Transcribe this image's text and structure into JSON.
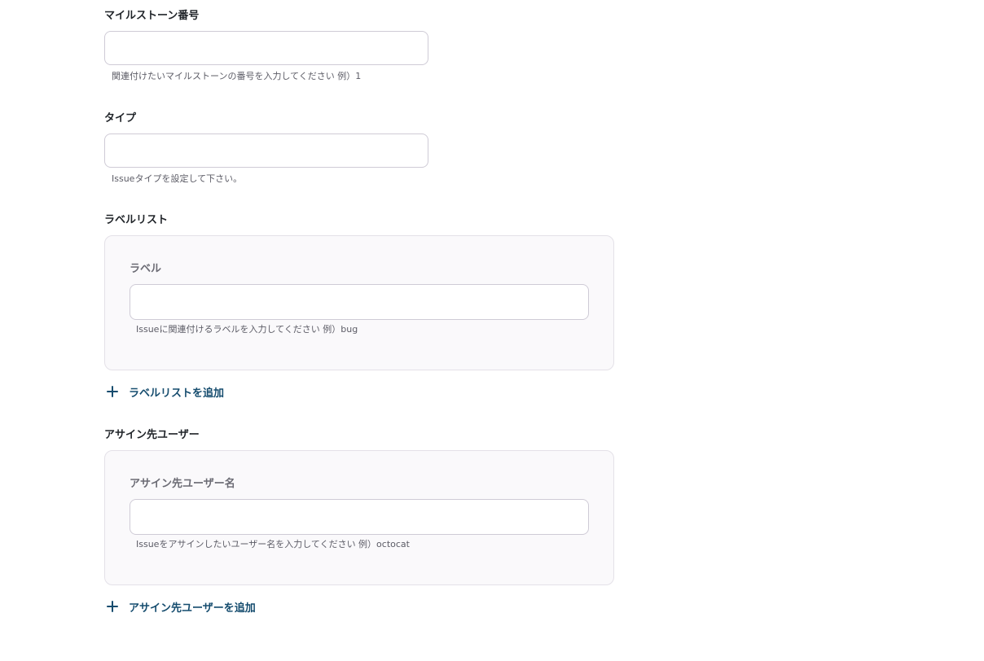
{
  "milestone": {
    "label": "マイルストーン番号",
    "value": "",
    "hint": "関連付けたいマイルストーンの番号を入力してください 例）1"
  },
  "type": {
    "label": "タイプ",
    "value": "",
    "hint": "Issueタイプを設定して下さい。"
  },
  "labels": {
    "label": "ラベルリスト",
    "item_label": "ラベル",
    "item_value": "",
    "item_hint": "Issueに関連付けるラベルを入力してください 例）bug",
    "add_label": "ラベルリストを追加",
    "add_icon": "plus-icon"
  },
  "assignees": {
    "label": "アサイン先ユーザー",
    "item_label": "アサイン先ユーザー名",
    "item_value": "",
    "item_hint": "Issueをアサインしたいユーザー名を入力してください 例）octocat",
    "add_label": "アサイン先ユーザーを追加",
    "add_icon": "plus-icon"
  },
  "colors": {
    "accent": "#154c6e",
    "input_border": "#cfcbd6",
    "panel_bg": "#faf9fb"
  }
}
